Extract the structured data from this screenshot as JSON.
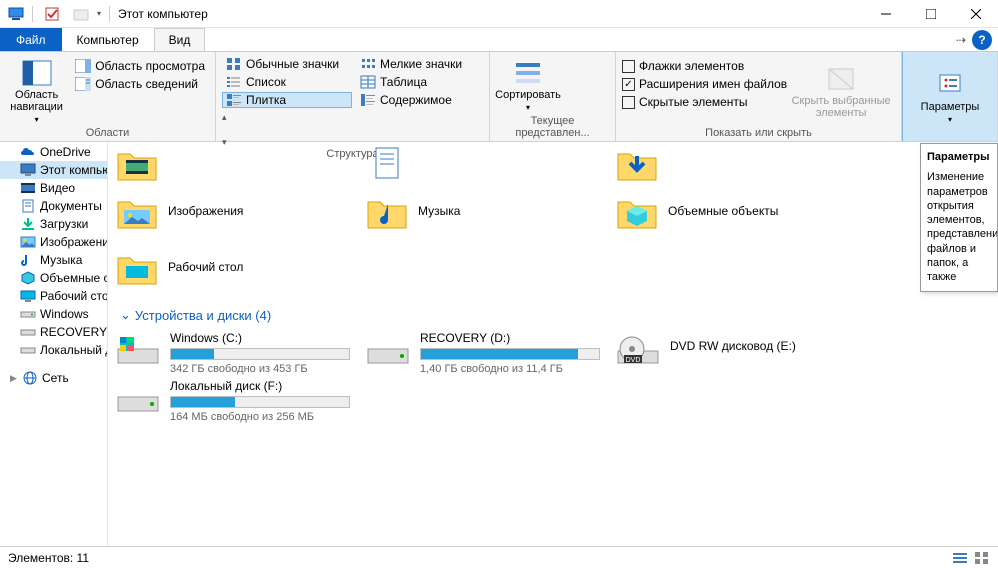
{
  "window_title": "Этот компьютер",
  "menubar": {
    "file": "Файл",
    "computer": "Компьютер",
    "view": "Вид"
  },
  "ribbon": {
    "panes": {
      "nav_pane": "Область навигации",
      "preview_pane": "Область просмотра",
      "details_pane": "Область сведений",
      "group_label": "Области"
    },
    "layout": {
      "icons_normal": "Обычные значки",
      "icons_small": "Мелкие значки",
      "list": "Список",
      "table": "Таблица",
      "tiles": "Плитка",
      "content": "Содержимое",
      "group_label": "Структура"
    },
    "current": {
      "sort": "Сортировать",
      "group_label": "Текущее представлен..."
    },
    "showhide": {
      "item_checkboxes": "Флажки элементов",
      "file_ext": "Расширения имен файлов",
      "hidden_items": "Скрытые элементы",
      "hide_selected": "Скрыть выбранные элементы",
      "group_label": "Показать или скрыть",
      "file_ext_checked": true
    },
    "options": {
      "label": "Параметры"
    }
  },
  "tree": {
    "onedrive": "OneDrive",
    "thispc": "Этот компьютер",
    "videos": "Видео",
    "documents": "Документы",
    "downloads": "Загрузки",
    "pictures": "Изображения",
    "music": "Музыка",
    "objects3d": "Объемные объекты",
    "desktop": "Рабочий стол",
    "windows": "Windows",
    "recovery": "RECOVERY",
    "local": "Локальный диск",
    "network": "Сеть"
  },
  "folders": {
    "pictures": "Изображения",
    "music": "Музыка",
    "objects3d": "Объемные объекты",
    "desktop": "Рабочий стол"
  },
  "section_drives": "Устройства и диски (4)",
  "chevron": "⌄",
  "drives": [
    {
      "name": "Windows (C:)",
      "free": "342 ГБ свободно из 453 ГБ",
      "fill_pct": 24
    },
    {
      "name": "RECOVERY (D:)",
      "free": "1,40 ГБ свободно из 11,4 ГБ",
      "fill_pct": 88
    },
    {
      "name": "DVD RW дисковод (E:)",
      "free": "",
      "fill_pct": -1
    },
    {
      "name": "Локальный диск (F:)",
      "free": "164 МБ свободно из 256 МБ",
      "fill_pct": 36
    }
  ],
  "status": {
    "count": "Элементов: 11"
  },
  "tooltip": {
    "title": "Параметры",
    "body": "Изменение параметров открытия элементов, представлений файлов и папок, а также"
  }
}
